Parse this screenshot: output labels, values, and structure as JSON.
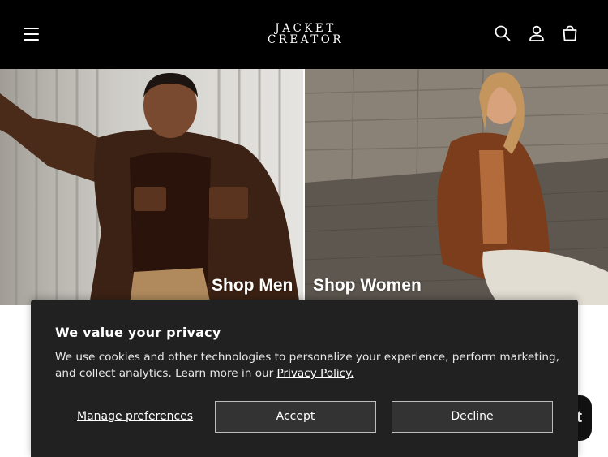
{
  "header": {
    "logo_line1": "JACKET",
    "logo_line2": "CREATOR",
    "icons": [
      "menu-icon",
      "search-icon",
      "account-icon",
      "cart-icon"
    ]
  },
  "hero": {
    "men_label": "Shop Men",
    "women_label": "Shop Women"
  },
  "chat": {
    "glyph": "t"
  },
  "cookie_banner": {
    "title": "We value your privacy",
    "text": "We use cookies and other technologies to personalize your experience, perform marketing, and collect analytics. Learn more in our ",
    "policy_link": "Privacy Policy.",
    "manage_label": "Manage preferences",
    "accept_label": "Accept",
    "decline_label": "Decline"
  },
  "colors": {
    "header_bg": "#000000",
    "banner_bg": "#212121",
    "button_bg": "#333333",
    "text": "#ffffff"
  }
}
